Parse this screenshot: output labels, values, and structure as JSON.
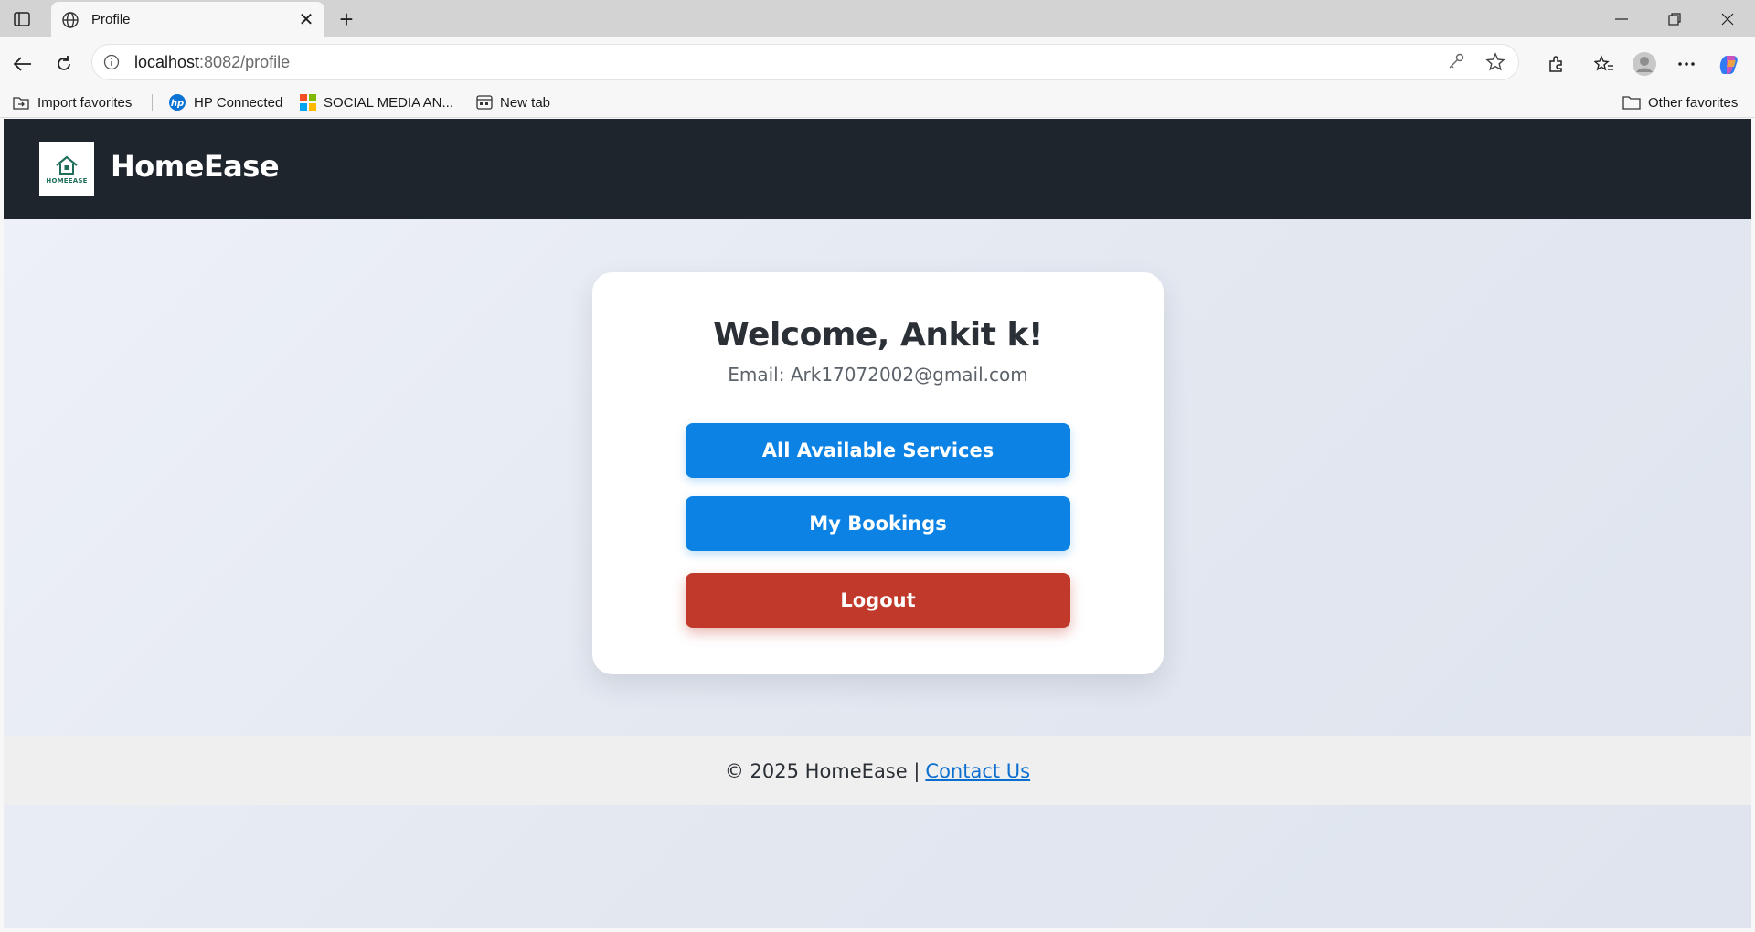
{
  "browser": {
    "tab_title": "Profile",
    "url_host": "localhost",
    "url_path": ":8082/profile",
    "favorites": [
      {
        "label": "Import favorites"
      },
      {
        "label": "HP Connected"
      },
      {
        "label": "SOCIAL MEDIA AN..."
      },
      {
        "label": "New tab"
      }
    ],
    "other_favorites": "Other favorites"
  },
  "app": {
    "brand": "HomeEase",
    "logo_text": "HOMEEASE"
  },
  "profile": {
    "welcome": "Welcome, Ankit k!",
    "email": "Email: Ark17072002@gmail.com",
    "services_button": "All Available Services",
    "bookings_button": "My Bookings",
    "logout_button": "Logout"
  },
  "footer": {
    "copyright": "© 2025 HomeEase |",
    "contact_link": "Contact Us"
  },
  "colors": {
    "header_bg": "#1f252d",
    "primary_button": "#0c83e4",
    "logout_button": "#c0392b",
    "link": "#0c6fd0"
  }
}
